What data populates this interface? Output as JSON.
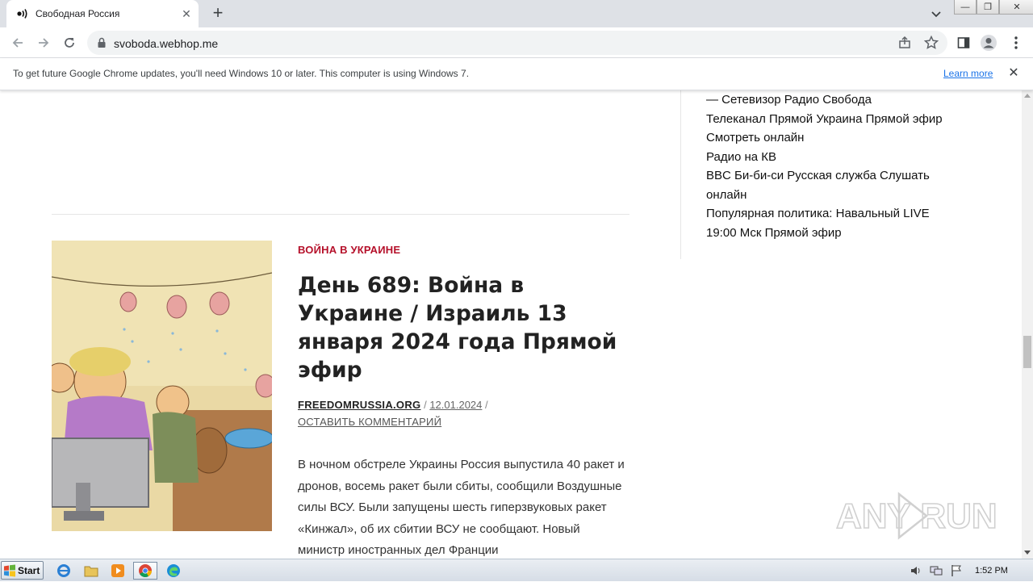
{
  "browser": {
    "tab_title": "Свободная Россия",
    "tab_close": "✕",
    "new_tab": "+",
    "url": "svoboda.webhop.me",
    "window_buttons": [
      "—",
      "❐",
      "✕"
    ]
  },
  "infobar": {
    "message": "To get future Google Chrome updates, you'll need Windows 10 or later. This computer is using Windows 7.",
    "learn_more": "Learn more",
    "close": "✕"
  },
  "sidebar": {
    "links": [
      "— Сетевизор Радио Свобода",
      "Телеканал Прямой Украина Прямой эфир",
      "Смотреть онлайн",
      "Радио на КВ",
      "BBC Би-би-си Русская служба Слушать",
      "онлайн",
      "Популярная политика: Навальный LIVE",
      "19:00 Мск Прямой эфир"
    ]
  },
  "article": {
    "category": "ВОЙНА В УКРАИНЕ",
    "title": "День 689: Война в Украине / Израиль 13 января 2024 года Прямой эфир",
    "author": "FREEDOMRUSSIA.ORG",
    "separator": "/",
    "date": "12.01.2024",
    "comment_link": "ОСТАВИТЬ КОММЕНТАРИЙ",
    "excerpt": "В ночном обстреле Украины Россия выпустила 40 ракет и дронов, восемь ракет были сбиты, сообщили Воздушные силы ВСУ. Были запущены шесть гиперзвуковых ракет «Кинжал», об их сбитии ВСУ не сообщают. Новый министр иностранных дел Франции"
  },
  "watermark": {
    "text": "ANY RUN"
  },
  "taskbar": {
    "start_label": "Start",
    "clock": "1:52 PM"
  },
  "colors": {
    "category_red": "#b5102a",
    "link_blue": "#1a73e8",
    "tabstrip": "#dee1e6"
  }
}
